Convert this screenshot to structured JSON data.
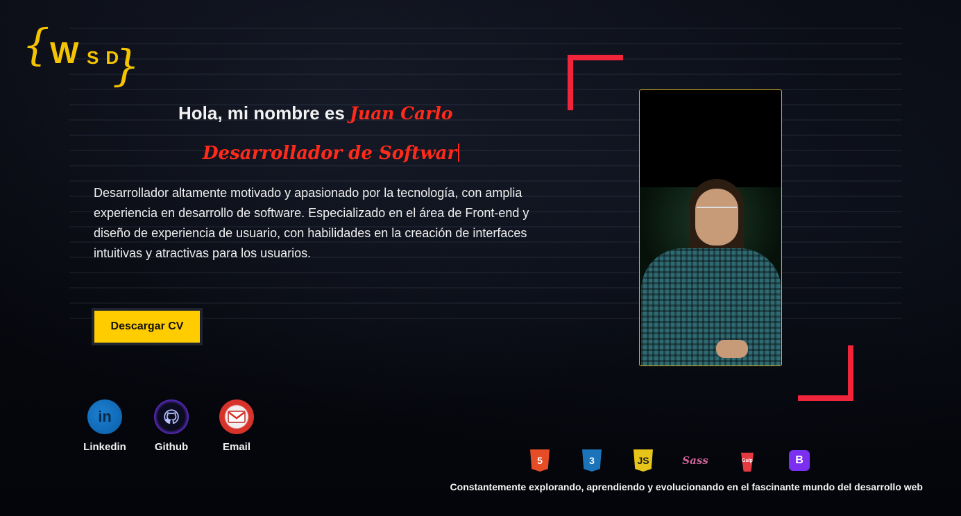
{
  "logo": {
    "brace_left": "{",
    "brace_right": "}",
    "w": "W",
    "sd": "SD"
  },
  "hero": {
    "greeting": "Hola, mi nombre es",
    "name": "Juan Carlo",
    "role": "Desarrollador de Softwar",
    "description": "Desarrollador altamente motivado y apasionado por la tecnología, con amplia experiencia en desarrollo de software. Especializado en el área de Front-end y diseño de experiencia de usuario, con habilidades en la creación de interfaces intuitivas y atractivas para los usuarios.",
    "cv_button": "Descargar CV"
  },
  "social": [
    {
      "label": "Linkedin",
      "icon": "linkedin-icon",
      "glyph": "in"
    },
    {
      "label": "Github",
      "icon": "github-icon",
      "glyph": "⌘"
    },
    {
      "label": "Email",
      "icon": "email-icon",
      "glyph": "✉"
    }
  ],
  "tech": [
    {
      "icon": "html5-icon",
      "glyph": "5"
    },
    {
      "icon": "css3-icon",
      "glyph": "3"
    },
    {
      "icon": "javascript-icon",
      "glyph": "JS"
    },
    {
      "icon": "sass-icon",
      "glyph": "Sass"
    },
    {
      "icon": "gulp-icon",
      "glyph": "Gulp"
    },
    {
      "icon": "bootstrap-icon",
      "glyph": "B"
    }
  ],
  "tagline": "Constantemente explorando, aprendiendo y evolucionando en el fascinante mundo del desarrollo web",
  "colors": {
    "accent_yellow": "#ffcc00",
    "accent_red": "#f0243a",
    "name_red": "#ff2a1a",
    "background": "#05060a"
  }
}
